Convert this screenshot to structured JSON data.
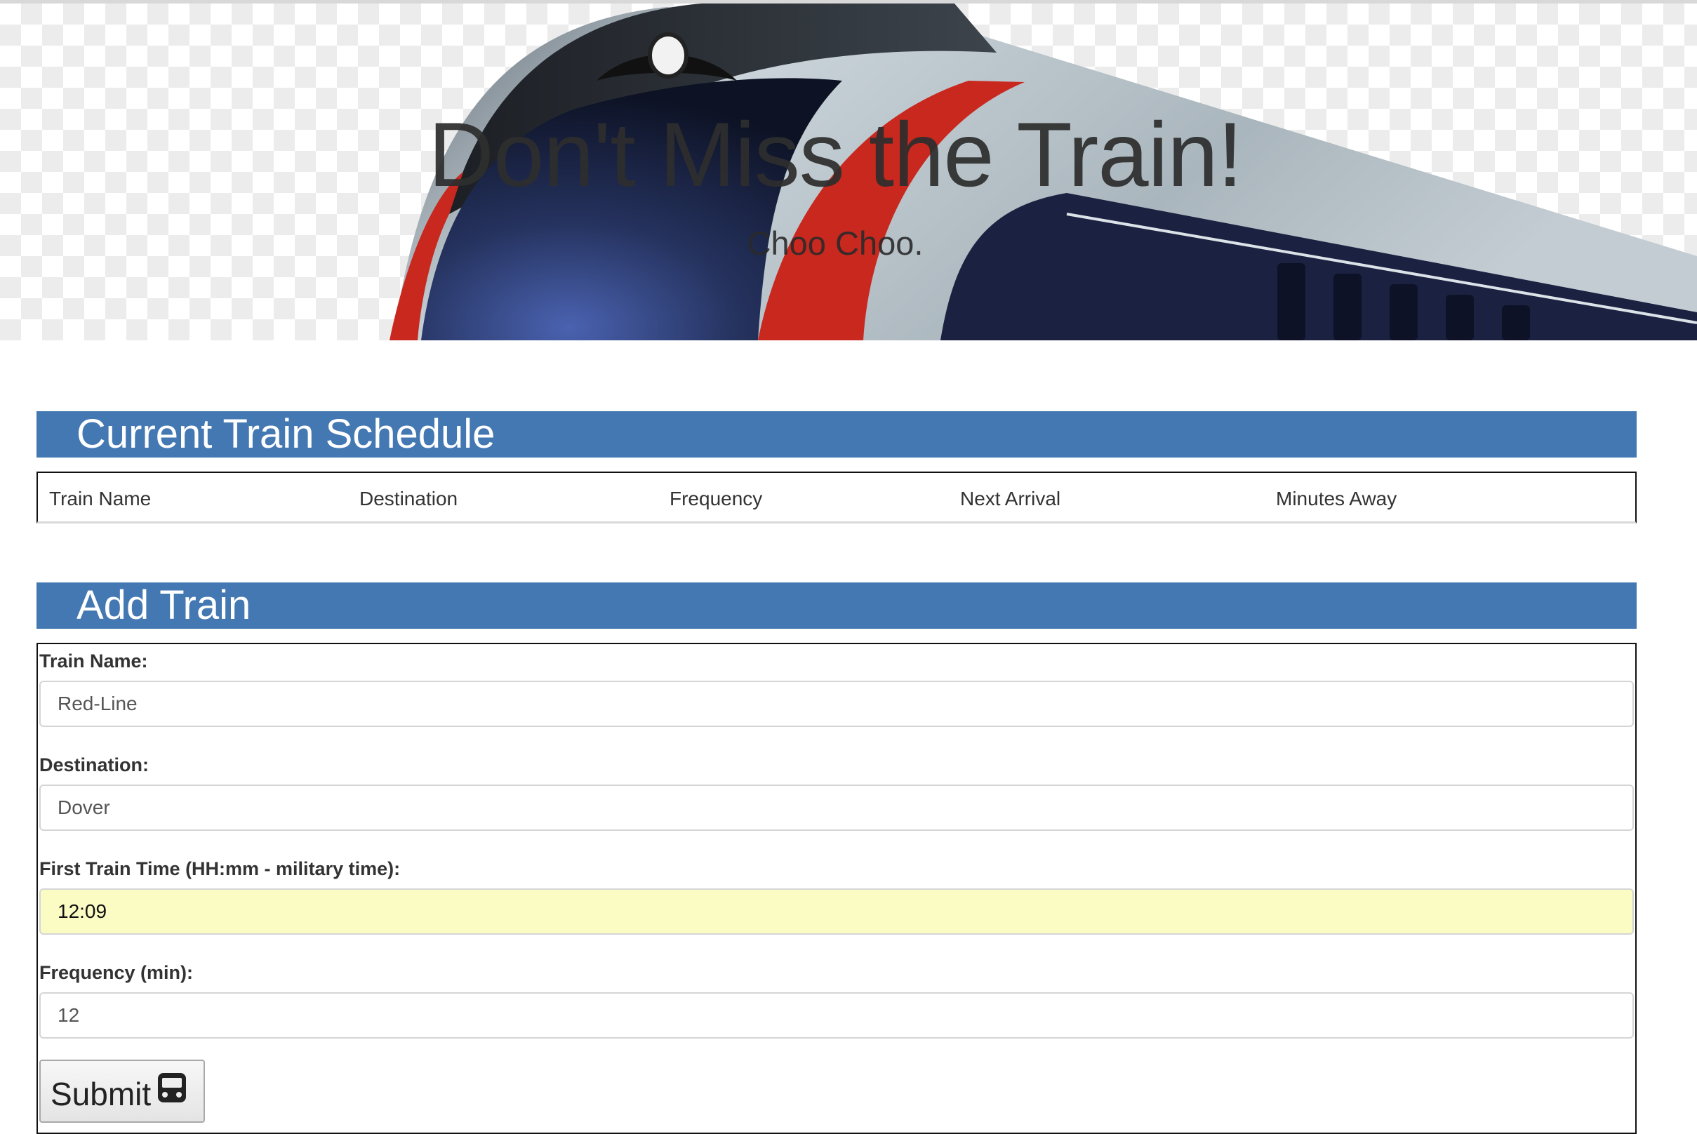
{
  "hero": {
    "title": "Don't Miss the Train!",
    "subtitle": "Choo Choo."
  },
  "schedule": {
    "heading": "Current Train Schedule",
    "columns": [
      "Train Name",
      "Destination",
      "Frequency",
      "Next Arrival",
      "Minutes Away"
    ]
  },
  "add_train": {
    "heading": "Add Train",
    "fields": {
      "train_name": {
        "label": "Train Name:",
        "value": "Red-Line"
      },
      "destination": {
        "label": "Destination:",
        "value": "Dover"
      },
      "first_time": {
        "label": "First Train Time (HH:mm - military time):",
        "value": "12:09"
      },
      "frequency": {
        "label": "Frequency (min):",
        "value": "12"
      }
    },
    "submit_label": "Submit",
    "submit_icon": "train-icon"
  },
  "colors": {
    "panel_header": "#4478b3",
    "autofill_bg": "#fbfbc4"
  }
}
